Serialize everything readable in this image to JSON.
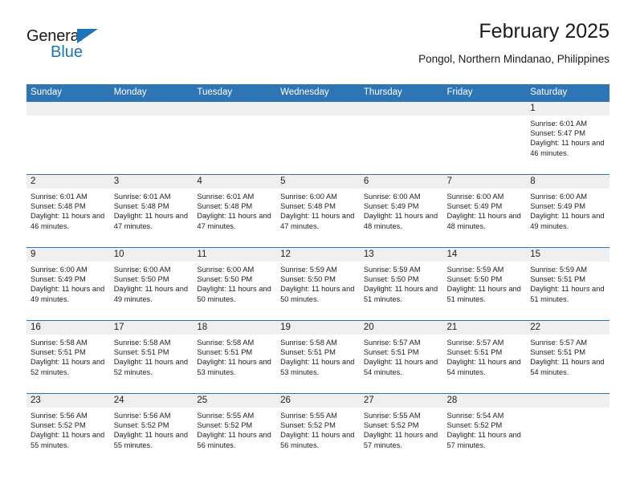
{
  "brand": {
    "name_part1": "General",
    "name_part2": "Blue",
    "accent_color": "#1b75bb"
  },
  "header": {
    "title": "February 2025",
    "subtitle": "Pongol, Northern Mindanao, Philippines"
  },
  "theme": {
    "header_blue": "#2e75b6",
    "day_band_gray": "#efefef",
    "text_color": "#222222"
  },
  "weekday_headers": [
    "Sunday",
    "Monday",
    "Tuesday",
    "Wednesday",
    "Thursday",
    "Friday",
    "Saturday"
  ],
  "labels": {
    "sunrise_prefix": "Sunrise:",
    "sunset_prefix": "Sunset:",
    "daylight_prefix": "Daylight:"
  },
  "weeks": [
    [
      {
        "day": "",
        "sunrise": "",
        "sunset": "",
        "daylight": "",
        "empty": true
      },
      {
        "day": "",
        "sunrise": "",
        "sunset": "",
        "daylight": "",
        "empty": true
      },
      {
        "day": "",
        "sunrise": "",
        "sunset": "",
        "daylight": "",
        "empty": true
      },
      {
        "day": "",
        "sunrise": "",
        "sunset": "",
        "daylight": "",
        "empty": true
      },
      {
        "day": "",
        "sunrise": "",
        "sunset": "",
        "daylight": "",
        "empty": true
      },
      {
        "day": "",
        "sunrise": "",
        "sunset": "",
        "daylight": "",
        "empty": true
      },
      {
        "day": "1",
        "sunrise": "Sunrise: 6:01 AM",
        "sunset": "Sunset: 5:47 PM",
        "daylight": "Daylight: 11 hours and 46 minutes.",
        "empty": false
      }
    ],
    [
      {
        "day": "2",
        "sunrise": "Sunrise: 6:01 AM",
        "sunset": "Sunset: 5:48 PM",
        "daylight": "Daylight: 11 hours and 46 minutes.",
        "empty": false
      },
      {
        "day": "3",
        "sunrise": "Sunrise: 6:01 AM",
        "sunset": "Sunset: 5:48 PM",
        "daylight": "Daylight: 11 hours and 47 minutes.",
        "empty": false
      },
      {
        "day": "4",
        "sunrise": "Sunrise: 6:01 AM",
        "sunset": "Sunset: 5:48 PM",
        "daylight": "Daylight: 11 hours and 47 minutes.",
        "empty": false
      },
      {
        "day": "5",
        "sunrise": "Sunrise: 6:00 AM",
        "sunset": "Sunset: 5:48 PM",
        "daylight": "Daylight: 11 hours and 47 minutes.",
        "empty": false
      },
      {
        "day": "6",
        "sunrise": "Sunrise: 6:00 AM",
        "sunset": "Sunset: 5:49 PM",
        "daylight": "Daylight: 11 hours and 48 minutes.",
        "empty": false
      },
      {
        "day": "7",
        "sunrise": "Sunrise: 6:00 AM",
        "sunset": "Sunset: 5:49 PM",
        "daylight": "Daylight: 11 hours and 48 minutes.",
        "empty": false
      },
      {
        "day": "8",
        "sunrise": "Sunrise: 6:00 AM",
        "sunset": "Sunset: 5:49 PM",
        "daylight": "Daylight: 11 hours and 49 minutes.",
        "empty": false
      }
    ],
    [
      {
        "day": "9",
        "sunrise": "Sunrise: 6:00 AM",
        "sunset": "Sunset: 5:49 PM",
        "daylight": "Daylight: 11 hours and 49 minutes.",
        "empty": false
      },
      {
        "day": "10",
        "sunrise": "Sunrise: 6:00 AM",
        "sunset": "Sunset: 5:50 PM",
        "daylight": "Daylight: 11 hours and 49 minutes.",
        "empty": false
      },
      {
        "day": "11",
        "sunrise": "Sunrise: 6:00 AM",
        "sunset": "Sunset: 5:50 PM",
        "daylight": "Daylight: 11 hours and 50 minutes.",
        "empty": false
      },
      {
        "day": "12",
        "sunrise": "Sunrise: 5:59 AM",
        "sunset": "Sunset: 5:50 PM",
        "daylight": "Daylight: 11 hours and 50 minutes.",
        "empty": false
      },
      {
        "day": "13",
        "sunrise": "Sunrise: 5:59 AM",
        "sunset": "Sunset: 5:50 PM",
        "daylight": "Daylight: 11 hours and 51 minutes.",
        "empty": false
      },
      {
        "day": "14",
        "sunrise": "Sunrise: 5:59 AM",
        "sunset": "Sunset: 5:50 PM",
        "daylight": "Daylight: 11 hours and 51 minutes.",
        "empty": false
      },
      {
        "day": "15",
        "sunrise": "Sunrise: 5:59 AM",
        "sunset": "Sunset: 5:51 PM",
        "daylight": "Daylight: 11 hours and 51 minutes.",
        "empty": false
      }
    ],
    [
      {
        "day": "16",
        "sunrise": "Sunrise: 5:58 AM",
        "sunset": "Sunset: 5:51 PM",
        "daylight": "Daylight: 11 hours and 52 minutes.",
        "empty": false
      },
      {
        "day": "17",
        "sunrise": "Sunrise: 5:58 AM",
        "sunset": "Sunset: 5:51 PM",
        "daylight": "Daylight: 11 hours and 52 minutes.",
        "empty": false
      },
      {
        "day": "18",
        "sunrise": "Sunrise: 5:58 AM",
        "sunset": "Sunset: 5:51 PM",
        "daylight": "Daylight: 11 hours and 53 minutes.",
        "empty": false
      },
      {
        "day": "19",
        "sunrise": "Sunrise: 5:58 AM",
        "sunset": "Sunset: 5:51 PM",
        "daylight": "Daylight: 11 hours and 53 minutes.",
        "empty": false
      },
      {
        "day": "20",
        "sunrise": "Sunrise: 5:57 AM",
        "sunset": "Sunset: 5:51 PM",
        "daylight": "Daylight: 11 hours and 54 minutes.",
        "empty": false
      },
      {
        "day": "21",
        "sunrise": "Sunrise: 5:57 AM",
        "sunset": "Sunset: 5:51 PM",
        "daylight": "Daylight: 11 hours and 54 minutes.",
        "empty": false
      },
      {
        "day": "22",
        "sunrise": "Sunrise: 5:57 AM",
        "sunset": "Sunset: 5:51 PM",
        "daylight": "Daylight: 11 hours and 54 minutes.",
        "empty": false
      }
    ],
    [
      {
        "day": "23",
        "sunrise": "Sunrise: 5:56 AM",
        "sunset": "Sunset: 5:52 PM",
        "daylight": "Daylight: 11 hours and 55 minutes.",
        "empty": false
      },
      {
        "day": "24",
        "sunrise": "Sunrise: 5:56 AM",
        "sunset": "Sunset: 5:52 PM",
        "daylight": "Daylight: 11 hours and 55 minutes.",
        "empty": false
      },
      {
        "day": "25",
        "sunrise": "Sunrise: 5:55 AM",
        "sunset": "Sunset: 5:52 PM",
        "daylight": "Daylight: 11 hours and 56 minutes.",
        "empty": false
      },
      {
        "day": "26",
        "sunrise": "Sunrise: 5:55 AM",
        "sunset": "Sunset: 5:52 PM",
        "daylight": "Daylight: 11 hours and 56 minutes.",
        "empty": false
      },
      {
        "day": "27",
        "sunrise": "Sunrise: 5:55 AM",
        "sunset": "Sunset: 5:52 PM",
        "daylight": "Daylight: 11 hours and 57 minutes.",
        "empty": false
      },
      {
        "day": "28",
        "sunrise": "Sunrise: 5:54 AM",
        "sunset": "Sunset: 5:52 PM",
        "daylight": "Daylight: 11 hours and 57 minutes.",
        "empty": false
      },
      {
        "day": "",
        "sunrise": "",
        "sunset": "",
        "daylight": "",
        "empty": true
      }
    ]
  ]
}
